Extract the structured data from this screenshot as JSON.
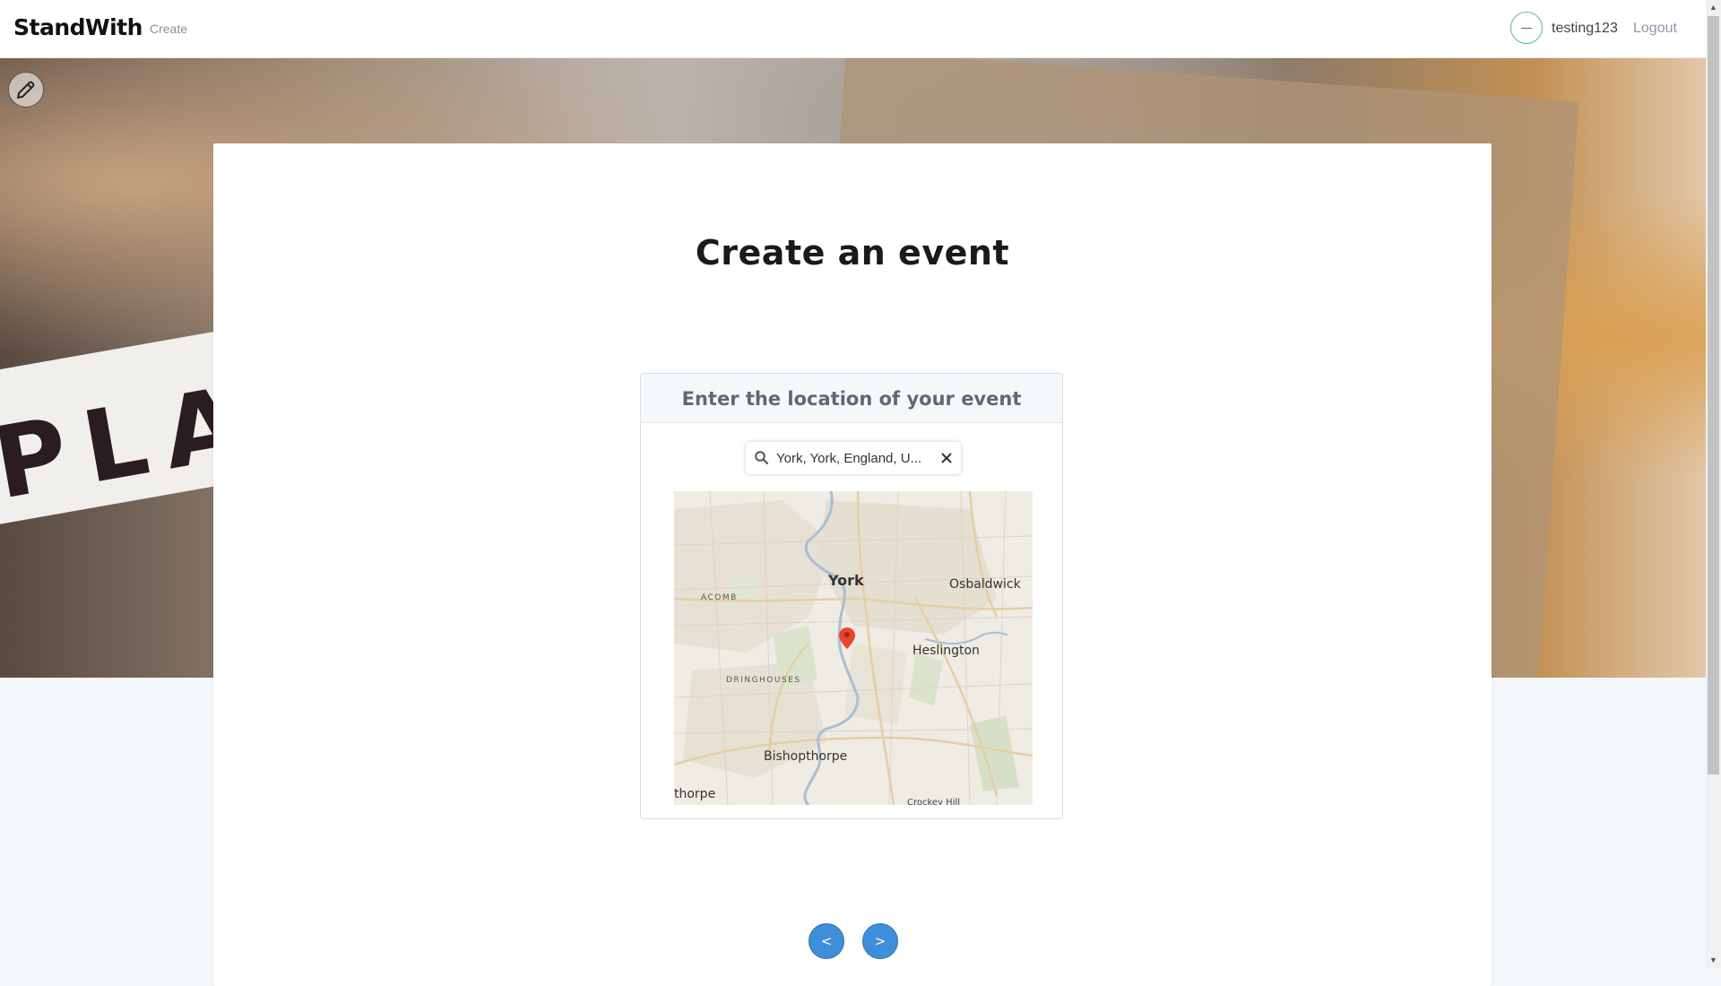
{
  "header": {
    "brand": "StandWith",
    "nav_create": "Create",
    "username": "testing123",
    "logout": "Logout"
  },
  "hero": {
    "sign_text": "PLA"
  },
  "main": {
    "title": "Create an event",
    "location_panel": {
      "heading": "Enter the location of your event",
      "search_value": "York, York, England, U...",
      "map_labels": {
        "york": "York",
        "osbaldwick": "Osbaldwick",
        "acomb": "ACOMB",
        "heslington": "Heslington",
        "dringhouses": "DRINGHOUSES",
        "bishopthorpe": "Bishopthorpe",
        "thorpe": "thorpe",
        "crockey_hill": "Crockey Hill"
      }
    },
    "prev_label": "<",
    "next_label": ">"
  },
  "colors": {
    "accent": "#3f8fd8",
    "marker": "#e8452c"
  }
}
